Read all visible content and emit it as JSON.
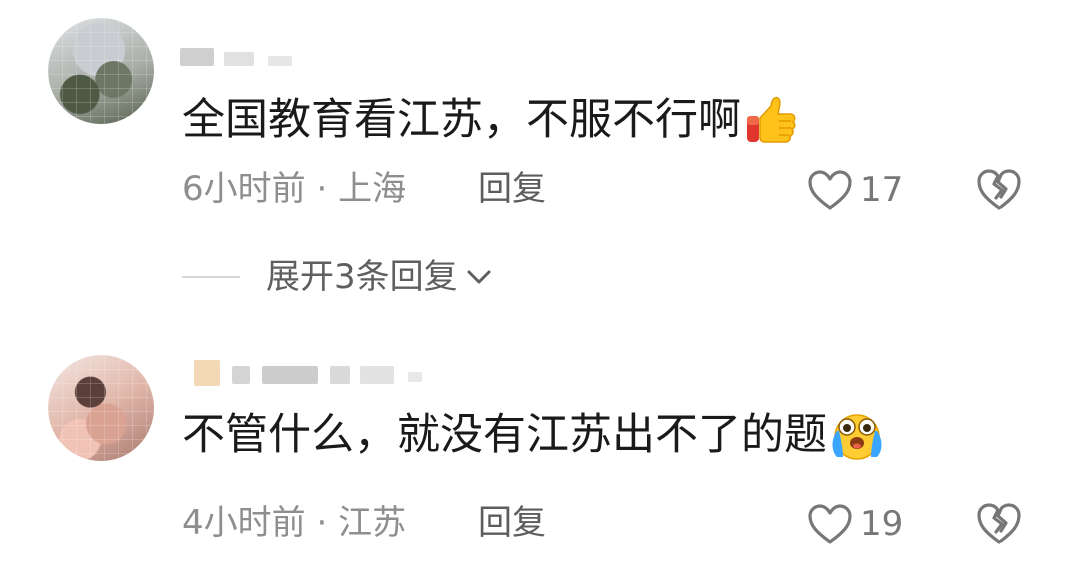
{
  "comments": [
    {
      "text": "全国教育看江苏，不服不行啊",
      "emoji": "thumbs-up-emoji",
      "time": "6小时前",
      "separator": " · ",
      "location": "上海",
      "reply_label": "回复",
      "likes": "17",
      "expand_replies_label": "展开3条回复"
    },
    {
      "text": "不管什么，就没有江苏出不了的题",
      "emoji": "crying-face-emoji",
      "time": "4小时前",
      "separator": " · ",
      "location": "江苏",
      "reply_label": "回复",
      "likes": "19"
    }
  ],
  "colors": {
    "text_primary": "#1a1a1a",
    "text_secondary": "#8e8e8e",
    "icon": "#777777",
    "background": "#ffffff"
  },
  "icons": [
    "heart-outline-icon",
    "broken-heart-icon",
    "chevron-down-icon"
  ]
}
